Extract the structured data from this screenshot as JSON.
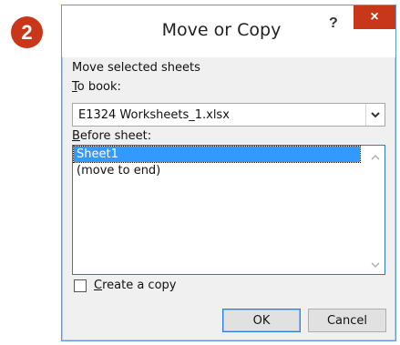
{
  "step_badge": "2",
  "dialog": {
    "title": "Move or Copy",
    "help_label": "?",
    "close_label": "×"
  },
  "form": {
    "move_selected_label": "Move selected sheets",
    "to_book_label_accel": "T",
    "to_book_label_rest": "o book:",
    "to_book_value": "E1324 Worksheets_1.xlsx",
    "before_sheet_label_accel": "B",
    "before_sheet_label_rest": "efore sheet:",
    "sheets": [
      "Sheet1",
      "(move to end)"
    ],
    "selected_sheet": "Sheet1",
    "create_copy_accel": "C",
    "create_copy_rest": "reate a copy",
    "create_copy_checked": false
  },
  "buttons": {
    "ok": "OK",
    "cancel": "Cancel"
  },
  "colors": {
    "badge": "#c8371a",
    "close_button": "#c8371a",
    "selection": "#3399ff",
    "dialog_border": "#5f9bd6"
  }
}
